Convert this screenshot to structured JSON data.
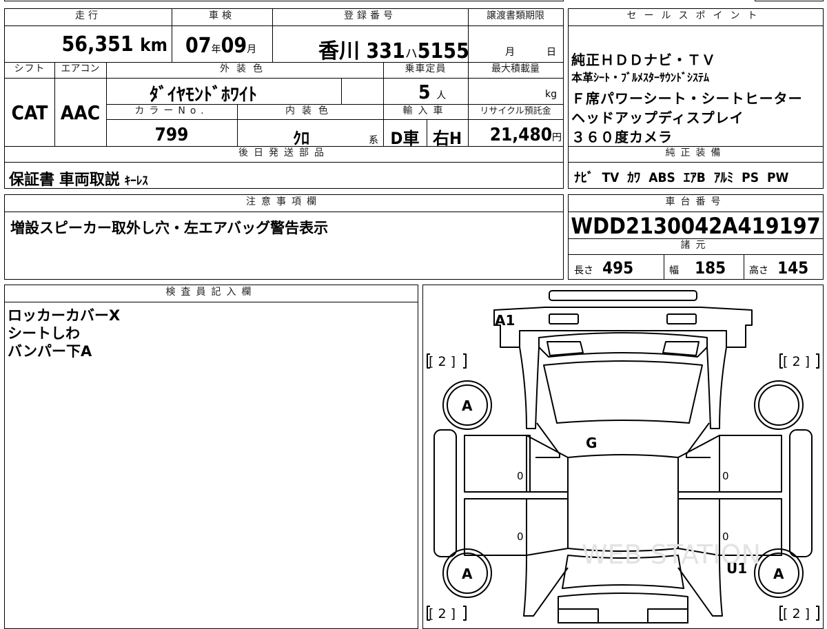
{
  "headers": {
    "mileage": "走行",
    "inspection": "車検",
    "registration": "登録番号",
    "transfer_deadline": "譲渡書類期限",
    "shift": "シフト",
    "aircon": "エアコン",
    "exterior_color": "外装色",
    "capacity": "乗車定員",
    "max_load": "最大積載量",
    "color_no": "カラーNo.",
    "interior_color": "内装色",
    "import": "輸入車",
    "recycle": "リサイクル預託金",
    "sales_point": "セールスポイント",
    "later_parts": "後日発送部品",
    "genuine_equipment": "純正装備",
    "notes": "注意事項欄",
    "chassis": "車台番号",
    "specs": "諸元",
    "inspector": "検査員記入欄"
  },
  "values": {
    "mileage": "56,351",
    "mileage_unit": "km",
    "insp_year": "07",
    "year_unit": "年",
    "insp_month": "09",
    "month_unit": "月",
    "reg_region": "香川",
    "reg_class": "331",
    "reg_kana": "ハ",
    "reg_number": "5155",
    "deadline_month": "月",
    "deadline_day": "日",
    "shift": "CAT",
    "aircon": "AAC",
    "exterior_color": "ﾀﾞｲﾔﾓﾝﾄﾞﾎﾜｲﾄ",
    "capacity": "5",
    "capacity_unit": "人",
    "load_unit": "kg",
    "color_no": "799",
    "interior_color": "ｸﾛ",
    "interior_suffix": "系",
    "import_type": "D車",
    "handle": "右H",
    "recycle": "21,480",
    "recycle_unit": "円",
    "later_parts": "保証書 車両取説",
    "later_parts_small": "ｷｰﾚｽ",
    "genuine_equipment": "ﾅﾋﾞ TV ｶﾜ ABS ｴｱB ｱﾙﾐ PS PW",
    "notes": "増設スピーカー取外し穴・左エアバッグ警告表示",
    "chassis": "WDD2130042A419197",
    "length_label": "長さ",
    "length": "495",
    "width_label": "幅",
    "width": "185",
    "height_label": "高さ",
    "height": "145"
  },
  "sales_points": [
    {
      "text": "純正ＨＤＤナビ・ＴＶ",
      "small": false
    },
    {
      "text": "本革ｼｰﾄ・ﾌﾞﾙﾒｽﾀｰｻｳﾝﾄﾞｼｽﾃﾑ",
      "small": true
    },
    {
      "text": "Ｆ席パワーシート・シートヒーター",
      "small": false
    },
    {
      "text": "ヘッドアップディスプレイ",
      "small": false
    },
    {
      "text": "３６０度カメラ",
      "small": false
    }
  ],
  "inspector_notes": [
    "ロッカーカバーX",
    "シートしわ",
    "バンパー下A"
  ],
  "diagram": {
    "front_bumper": "A1",
    "windshield": "G",
    "rear_quarter": "U1",
    "wheel_fl": "A",
    "wheel_fr": "",
    "wheel_rl": "A",
    "wheel_rr": "A",
    "tire_fl": "[ 2 ]",
    "tire_fr": "[ 2 ]",
    "tire_rl": "[ 2 ]",
    "tire_rr": "[ 2 ]",
    "door_mark_fl": "0",
    "door_mark_rl": "0",
    "door_mark_fr": "0",
    "door_mark_rr": "0",
    "watermark": "WEB STATION"
  }
}
